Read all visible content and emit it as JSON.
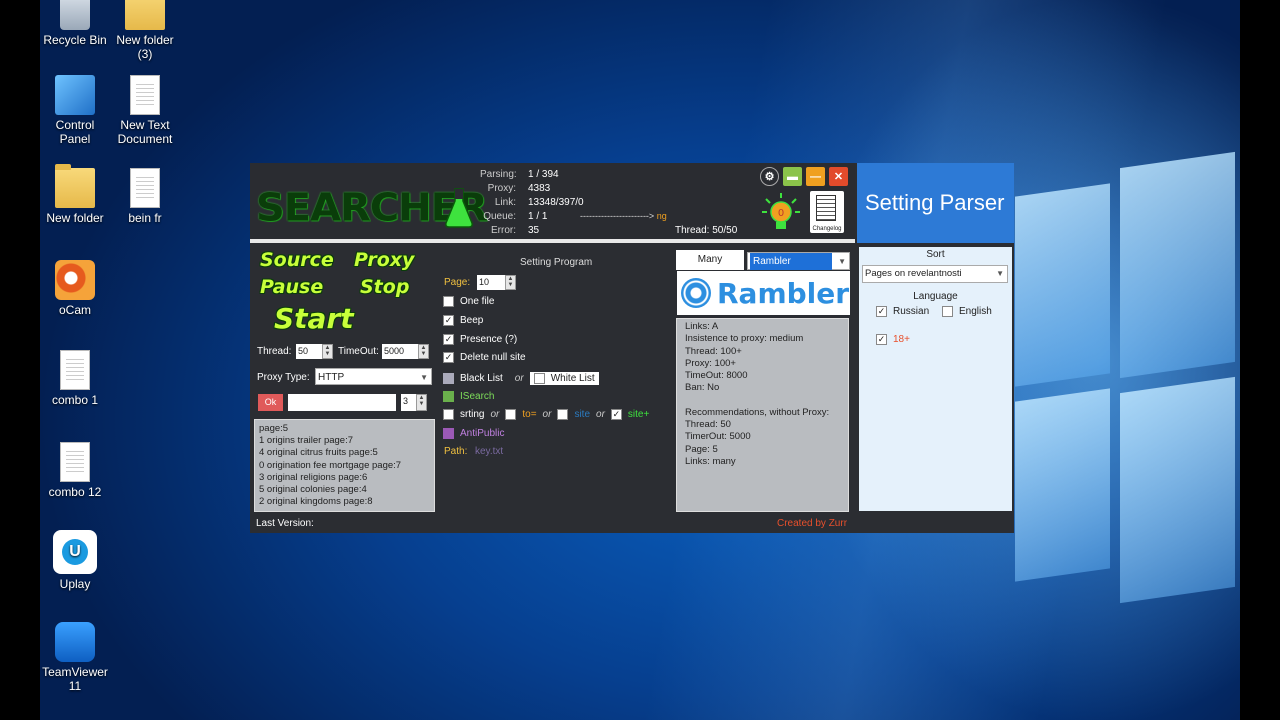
{
  "desktop": {
    "icons": [
      {
        "label": "Recycle Bin",
        "kind": "recycle"
      },
      {
        "label": "New folder\n(3)",
        "kind": "folder"
      },
      {
        "label": "Control\nPanel",
        "kind": "control"
      },
      {
        "label": "New Text\nDocument",
        "kind": "doc"
      },
      {
        "label": "New folder",
        "kind": "folder"
      },
      {
        "label": "bein fr",
        "kind": "doc"
      },
      {
        "label": "oCam",
        "kind": "ocam"
      },
      {
        "label": "combo 1",
        "kind": "doc"
      },
      {
        "label": "combo 12",
        "kind": "doc"
      },
      {
        "label": "Uplay",
        "kind": "uplay"
      },
      {
        "label": "TeamViewer\n11",
        "kind": "teamviewer"
      }
    ]
  },
  "app": {
    "logo": "SEARCHER",
    "stats": [
      {
        "key": "Parsing:",
        "value": "1 / 394"
      },
      {
        "key": "Proxy:",
        "value": "4383"
      },
      {
        "key": "Link:",
        "value": "13348/397/0"
      },
      {
        "key": "Queue:",
        "value": "1 / 1"
      },
      {
        "key": "Error:",
        "value": "35"
      }
    ],
    "progress_text": "-----------------------> ",
    "progress_suffix": "ng",
    "thread_stat": "Thread:  50/50",
    "changelog_label": "Changelog",
    "bulb_value": "0",
    "buttons": {
      "source": "Source",
      "proxy": "Proxy",
      "pause": "Pause",
      "stop": "Stop",
      "start": "Start",
      "ok": "Ok"
    },
    "thread_label": "Thread:",
    "thread_value": "50",
    "timeout_label": "TimeOut:",
    "timeout_value": "5000",
    "proxy_type_label": "Proxy Type:",
    "proxy_type_value": "HTTP",
    "ok_input_value": "",
    "ok_count": "3",
    "log_lines": [
      "page:5",
      "1 origins trailer page:7",
      "4 original citrus fruits page:5",
      "0 origination fee mortgage page:7",
      "3 original religions page:6",
      "5 original colonies page:4",
      "2 original kingdoms page:8"
    ],
    "setting_program": {
      "title": "Setting Program",
      "page_label": "Page:",
      "page_value": "10",
      "one_file": "One file",
      "beep": "Beep",
      "presence": "Presence (?)",
      "delete_null": "Delete null site",
      "black_list": "Black List",
      "or": "or",
      "white_list": "White List",
      "isearch": "ISearch",
      "srting": "srting",
      "to": "to=",
      "site": "site",
      "site_plus": "site+",
      "antipublic": "AntiPublic",
      "path_label": "Path:",
      "path_value": "key.txt"
    },
    "engine": {
      "mode_button": "Many",
      "selected": "Rambler",
      "brand": "Rambler",
      "info_lines": [
        "Links: A",
        "Insistence to proxy: medium",
        "Thread: 100+",
        "Proxy: 100+",
        "TimeOut: 8000",
        "Ban: No",
        "",
        "Recommendations, without Proxy:",
        "Thread: 50",
        "TimerOut: 5000",
        "Page: 5",
        "Links: many"
      ]
    },
    "last_version_label": "Last Version:",
    "created_by": "Created by Zurr"
  },
  "setting_parser": {
    "title": "Setting Parser",
    "sort_label": "Sort",
    "sort_value": "Pages on revelantnosti",
    "language_label": "Language",
    "russian": "Russian",
    "english": "English",
    "adult": "18+"
  },
  "colors": {
    "accent_blue": "#2d7ad6",
    "created_by": "#e8502c",
    "neon_green": "#c8ff3a"
  }
}
